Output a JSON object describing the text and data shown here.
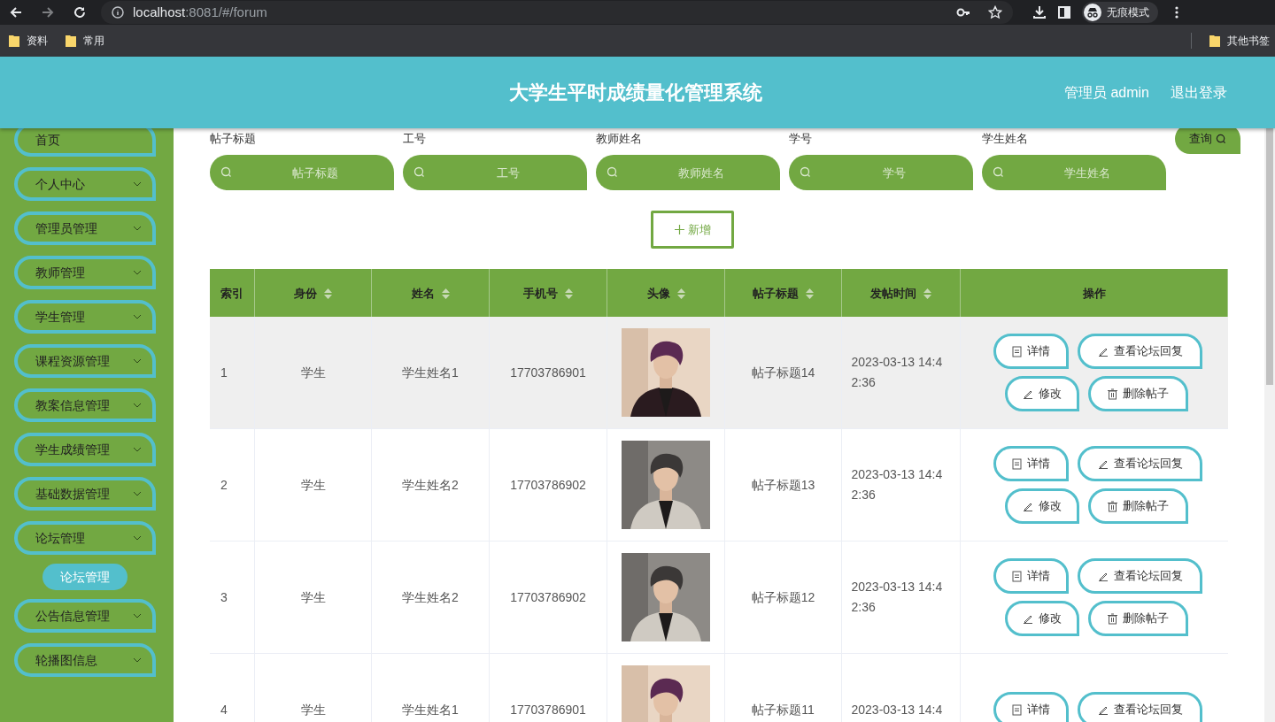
{
  "browser": {
    "url_host": "localhost",
    "url_rest": ":8081/#/forum",
    "profile": "无痕模式",
    "bookmarks": [
      "资料",
      "常用"
    ],
    "other_bookmarks": "其他书签"
  },
  "header": {
    "title": "大学生平时成绩量化管理系统",
    "user": "管理员 admin",
    "logout": "退出登录"
  },
  "sidebar": {
    "items": [
      {
        "label": "首页",
        "expandable": false
      },
      {
        "label": "个人中心",
        "expandable": true
      },
      {
        "label": "管理员管理",
        "expandable": true
      },
      {
        "label": "教师管理",
        "expandable": true
      },
      {
        "label": "学生管理",
        "expandable": true
      },
      {
        "label": "课程资源管理",
        "expandable": true
      },
      {
        "label": "教案信息管理",
        "expandable": true
      },
      {
        "label": "学生成绩管理",
        "expandable": true
      },
      {
        "label": "基础数据管理",
        "expandable": true
      },
      {
        "label": "论坛管理",
        "expandable": true,
        "children": [
          {
            "label": "论坛管理",
            "selected": true
          }
        ]
      },
      {
        "label": "公告信息管理",
        "expandable": true
      },
      {
        "label": "轮播图信息",
        "expandable": true
      }
    ]
  },
  "filters": [
    {
      "label": "帖子标题",
      "placeholder": "帖子标题"
    },
    {
      "label": "工号",
      "placeholder": "工号"
    },
    {
      "label": "教师姓名",
      "placeholder": "教师姓名"
    },
    {
      "label": "学号",
      "placeholder": "学号"
    },
    {
      "label": "学生姓名",
      "placeholder": "学生姓名"
    }
  ],
  "search_button": "查询",
  "add_button": "新增",
  "table": {
    "columns": [
      {
        "label": "索引",
        "sortable": false
      },
      {
        "label": "身份",
        "sortable": true
      },
      {
        "label": "姓名",
        "sortable": true
      },
      {
        "label": "手机号",
        "sortable": true
      },
      {
        "label": "头像",
        "sortable": true
      },
      {
        "label": "帖子标题",
        "sortable": true
      },
      {
        "label": "发帖时间",
        "sortable": true
      },
      {
        "label": "操作",
        "sortable": false
      }
    ],
    "rows": [
      {
        "index": "1",
        "role": "学生",
        "name": "学生姓名1",
        "phone": "17703786901",
        "title": "帖子标题14",
        "time": "2023-03-13 14:42:36",
        "hovered": true,
        "actions": [
          "详情",
          "查看论坛回复",
          "修改",
          "删除帖子"
        ]
      },
      {
        "index": "2",
        "role": "学生",
        "name": "学生姓名2",
        "phone": "17703786902",
        "title": "帖子标题13",
        "time": "2023-03-13 14:42:36",
        "hovered": false,
        "actions": [
          "详情",
          "查看论坛回复",
          "修改",
          "删除帖子"
        ]
      },
      {
        "index": "3",
        "role": "学生",
        "name": "学生姓名2",
        "phone": "17703786902",
        "title": "帖子标题12",
        "time": "2023-03-13 14:42:36",
        "hovered": false,
        "actions": [
          "详情",
          "查看论坛回复",
          "修改",
          "删除帖子"
        ]
      },
      {
        "index": "4",
        "role": "学生",
        "name": "学生姓名1",
        "phone": "17703786901",
        "title": "帖子标题11",
        "time": "2023-03-13 14:4",
        "hovered": false,
        "actions": [
          "详情",
          "查看论坛回复"
        ]
      }
    ]
  }
}
